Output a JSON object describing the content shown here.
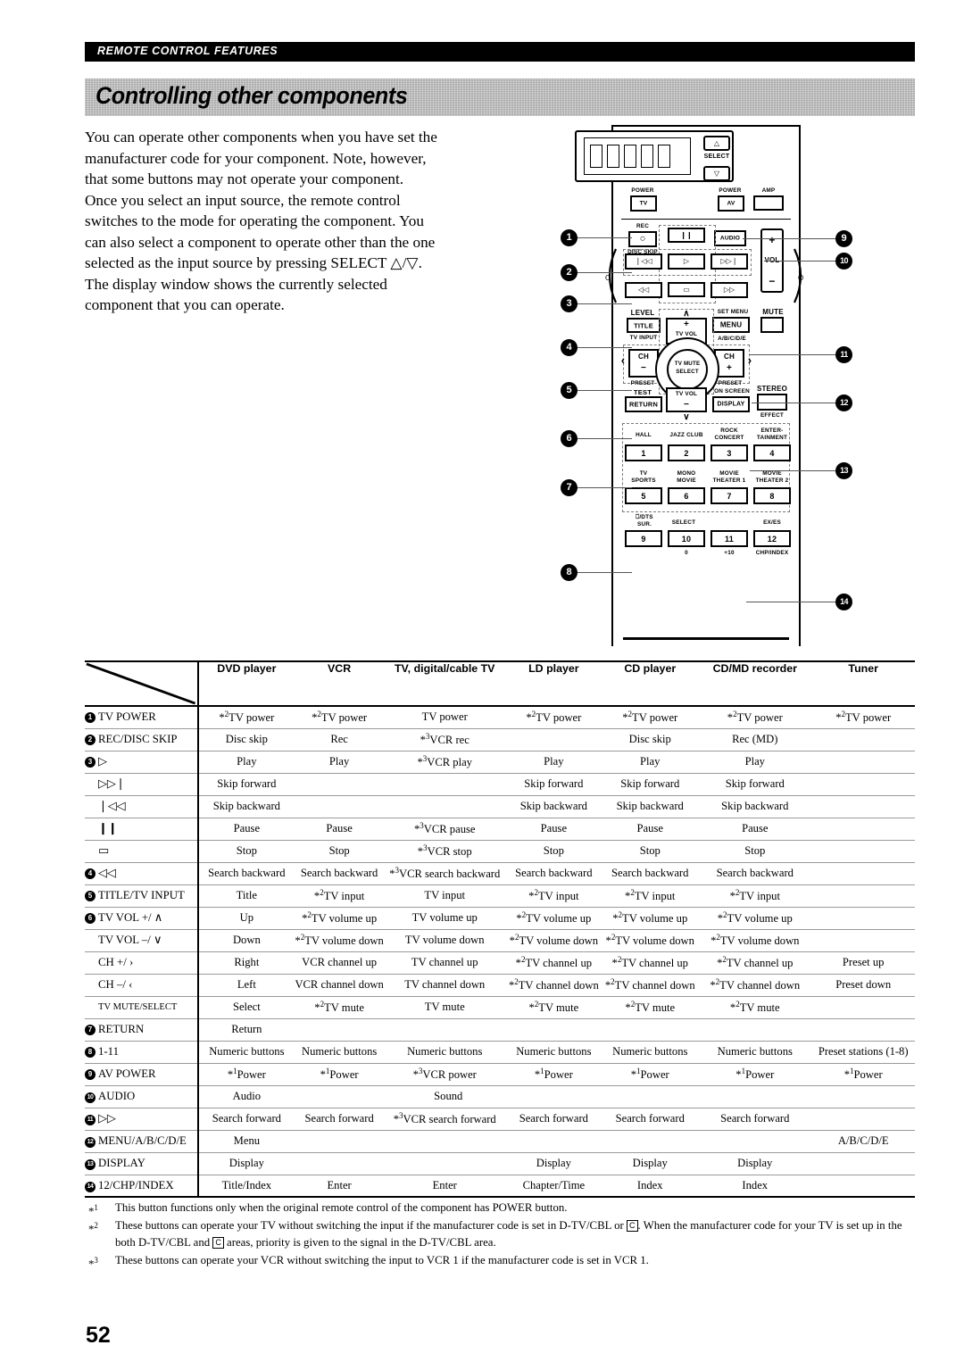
{
  "header": {
    "running_head": "REMOTE CONTROL FEATURES"
  },
  "banner": {
    "title": "Controlling other components"
  },
  "intro": {
    "lines": [
      "You can operate other components when you have set the",
      "manufacturer code for your component. Note, however,",
      "that some buttons may not operate your component.",
      "Once you select an input source, the remote control",
      "switches to the mode for operating the component. You",
      "can also select a component to operate other than the one",
      "selected as the input source by pressing SELECT △/▽.",
      "The display window shows the currently selected",
      "component that you can operate."
    ]
  },
  "remote": {
    "select_label": "SELECT",
    "up_glyph": "△",
    "down_glyph": "▽",
    "power_tv_label": "POWER",
    "power_tv": "TV",
    "power_av_label": "POWER",
    "power_av": "AV",
    "amp_label": "AMP",
    "rec_label": "REC",
    "rec_glyph": "○",
    "disc_skip_label": "DISC SKIP",
    "audio": "AUDIO",
    "vol_plus": "+",
    "vol": "VOL",
    "vol_minus": "−",
    "pause_glyph": "❙❙",
    "skip_back_glyph": "❘◁◁",
    "play_glyph": "▷",
    "skip_fwd_glyph": "▷▷❘",
    "stop_glyph": "▭",
    "search_back_glyph": "◁◁",
    "search_fwd_glyph": "▷▷",
    "level_label": "LEVEL",
    "title": "TITLE",
    "tv_input_label": "TV INPUT",
    "set_menu_label": "SET MENU",
    "menu": "MENU",
    "abcde_label": "A/B/C/D/E",
    "mute_label": "MUTE",
    "tv_vol_up_caret": "∧",
    "tv_vol_up_plus": "+",
    "tv_vol_up_lbl": "TV VOL",
    "ch_minus_ch": "CH",
    "ch_minus_sign": "−",
    "ch_plus_ch": "CH",
    "ch_plus_sign": "+",
    "left_caret": "‹",
    "right_caret": "›",
    "preset_left": "PRESET",
    "preset_right": "PRESET",
    "dial_line1": "TV MUTE",
    "dial_line2": "SELECT",
    "test_label": "TEST",
    "return": "RETURN",
    "tv_vol_dn_lbl": "TV VOL",
    "tv_vol_dn_minus": "−",
    "tv_vol_dn_caret": "∨",
    "on_screen_label": "ON SCREEN",
    "display": "DISPLAY",
    "stereo_label": "STEREO",
    "effect_label": "EFFECT",
    "dsp": [
      {
        "top": "HALL",
        "num": "1"
      },
      {
        "top": "JAZZ CLUB",
        "num": "2"
      },
      {
        "top": "ROCK\nCONCERT",
        "num": "3"
      },
      {
        "top": "ENTER-\nTAINMENT",
        "num": "4"
      },
      {
        "top": "TV\nSPORTS",
        "num": "5"
      },
      {
        "top": "MONO\nMOVIE",
        "num": "6"
      },
      {
        "top": "MOVIE\nTHEATER 1",
        "num": "7"
      },
      {
        "top": "MOVIE\nTHEATER 2",
        "num": "8"
      }
    ],
    "row9": {
      "l9_top1": "⎕/DTS",
      "l9_top2": "SUR.",
      "n9": "9",
      "select_mid": "SELECT",
      "n10": "10",
      "sub10": "0",
      "n11": "11",
      "sub11": "+10",
      "exes": "EX/ES",
      "n12": "12",
      "chp_index": "CHP/INDEX"
    },
    "callouts_left": [
      "1",
      "2",
      "3",
      "4",
      "5",
      "6",
      "7",
      "8"
    ],
    "callouts_right": [
      "9",
      "10",
      "11",
      "12",
      "13",
      "14"
    ]
  },
  "table": {
    "columns": [
      "DVD player",
      "VCR",
      "TV, digital/cable TV",
      "LD player",
      "CD player",
      "CD/MD recorder",
      "Tuner"
    ],
    "rows": [
      {
        "num": "1",
        "label": "TV POWER",
        "indent": false,
        "cells": [
          "*2TV power",
          "*2TV power",
          "TV power",
          "*2TV power",
          "*2TV power",
          "*2TV power",
          "*2TV power"
        ]
      },
      {
        "num": "2",
        "label": "REC/DISC SKIP",
        "indent": false,
        "cells": [
          "Disc skip",
          "Rec",
          "*3VCR rec",
          "",
          "Disc skip",
          "Rec (MD)",
          ""
        ]
      },
      {
        "num": "3",
        "label": "▷",
        "indent": false,
        "cells": [
          "Play",
          "Play",
          "*3VCR play",
          "Play",
          "Play",
          "Play",
          ""
        ]
      },
      {
        "num": "",
        "label": "▷▷❘",
        "indent": true,
        "cells": [
          "Skip forward",
          "",
          "",
          "Skip forward",
          "Skip forward",
          "Skip forward",
          ""
        ]
      },
      {
        "num": "",
        "label": "❘◁◁",
        "indent": true,
        "cells": [
          "Skip backward",
          "",
          "",
          "Skip backward",
          "Skip backward",
          "Skip backward",
          ""
        ]
      },
      {
        "num": "",
        "label": "❙❙",
        "indent": true,
        "cells": [
          "Pause",
          "Pause",
          "*3VCR pause",
          "Pause",
          "Pause",
          "Pause",
          ""
        ]
      },
      {
        "num": "",
        "label": "▭",
        "indent": true,
        "cells": [
          "Stop",
          "Stop",
          "*3VCR stop",
          "Stop",
          "Stop",
          "Stop",
          ""
        ]
      },
      {
        "num": "4",
        "label": "◁◁",
        "indent": false,
        "cells": [
          "Search backward",
          "Search backward",
          "*3VCR search backward",
          "Search backward",
          "Search backward",
          "Search backward",
          ""
        ]
      },
      {
        "num": "5",
        "label": "TITLE/TV INPUT",
        "indent": false,
        "cells": [
          "Title",
          "*2TV input",
          "TV input",
          "*2TV input",
          "*2TV input",
          "*2TV input",
          ""
        ]
      },
      {
        "num": "6",
        "label": "TV VOL +/ ∧",
        "indent": false,
        "cells": [
          "Up",
          "*2TV volume up",
          "TV volume up",
          "*2TV volume up",
          "*2TV volume up",
          "*2TV volume up",
          ""
        ]
      },
      {
        "num": "",
        "label": "TV VOL –/ ∨",
        "indent": true,
        "cells": [
          "Down",
          "*2TV volume down",
          "TV volume down",
          "*2TV volume down",
          "*2TV volume down",
          "*2TV volume down",
          ""
        ]
      },
      {
        "num": "",
        "label": "CH +/ ›",
        "indent": true,
        "cells": [
          "Right",
          "VCR channel up",
          "TV channel up",
          "*2TV channel up",
          "*2TV channel up",
          "*2TV channel up",
          "Preset up"
        ]
      },
      {
        "num": "",
        "label": "CH –/ ‹",
        "indent": true,
        "cells": [
          "Left",
          "VCR channel down",
          "TV channel down",
          "*2TV channel down",
          "*2TV channel down",
          "*2TV channel down",
          "Preset down"
        ]
      },
      {
        "num": "",
        "label": "TV MUTE/SELECT",
        "indent": true,
        "small": true,
        "cells": [
          "Select",
          "*2TV mute",
          "TV mute",
          "*2TV mute",
          "*2TV mute",
          "*2TV mute",
          ""
        ]
      },
      {
        "num": "7",
        "label": "RETURN",
        "indent": false,
        "cells": [
          "Return",
          "",
          "",
          "",
          "",
          "",
          ""
        ]
      },
      {
        "num": "8",
        "label": "1-11",
        "indent": false,
        "cells": [
          "Numeric buttons",
          "Numeric buttons",
          "Numeric buttons",
          "Numeric buttons",
          "Numeric buttons",
          "Numeric buttons",
          "Preset stations (1-8)"
        ]
      },
      {
        "num": "9",
        "label": "AV POWER",
        "indent": false,
        "cells": [
          "*1Power",
          "*1Power",
          "*3VCR power",
          "*1Power",
          "*1Power",
          "*1Power",
          "*1Power"
        ]
      },
      {
        "num": "10",
        "label": "AUDIO",
        "indent": false,
        "cells": [
          "Audio",
          "",
          "Sound",
          "",
          "",
          "",
          ""
        ],
        "span_sound": true
      },
      {
        "num": "11",
        "label": "▷▷",
        "indent": false,
        "cells": [
          "Search forward",
          "Search forward",
          "*3VCR search forward",
          "Search forward",
          "Search forward",
          "Search forward",
          ""
        ]
      },
      {
        "num": "12",
        "label": "MENU/A/B/C/D/E",
        "indent": false,
        "cells": [
          "Menu",
          "",
          "",
          "",
          "",
          "",
          "A/B/C/D/E"
        ]
      },
      {
        "num": "13",
        "label": "DISPLAY",
        "indent": false,
        "cells": [
          "Display",
          "",
          "",
          "Display",
          "Display",
          "Display",
          ""
        ]
      },
      {
        "num": "14",
        "label": "12/CHP/INDEX",
        "indent": false,
        "cells": [
          "Title/Index",
          "Enter",
          "Enter",
          "Chapter/Time",
          "Index",
          "Index",
          ""
        ]
      }
    ]
  },
  "footnotes": [
    {
      "mark": "*1",
      "parts": [
        "This button functions only when the original remote control of the component has POWER button."
      ]
    },
    {
      "mark": "*2",
      "parts": [
        "These buttons can operate your TV without switching the input if the manufacturer code is set in D-TV/CBL or ",
        "C",
        ". When the manufacturer code for your TV is set up in the both D-TV/CBL and ",
        "C",
        " areas, priority is given to the signal in the D-TV/CBL area."
      ]
    },
    {
      "mark": "*3",
      "parts": [
        "These buttons can operate your VCR without switching the input to VCR 1 if the manufacturer code is set in VCR 1."
      ]
    }
  ],
  "page_number": "52"
}
